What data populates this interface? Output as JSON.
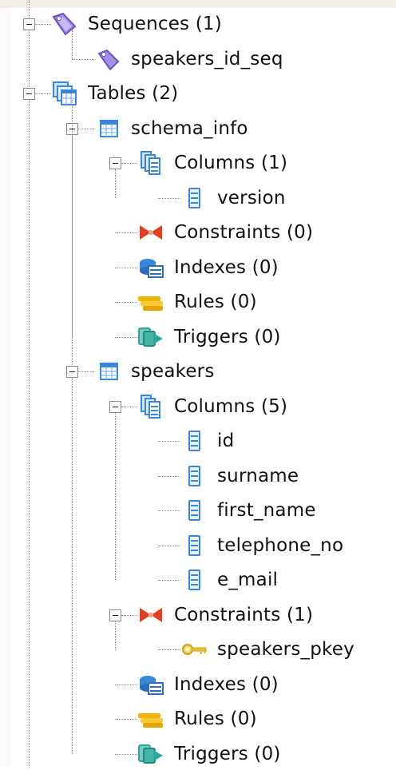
{
  "tree": {
    "sequences": {
      "label": "Sequences (1)",
      "icon": "sequences-icon",
      "items": [
        {
          "label": "speakers_id_seq",
          "icon": "sequence-icon"
        }
      ]
    },
    "tables": {
      "label": "Tables (2)",
      "icon": "tables-icon",
      "items": [
        {
          "label": "schema_info",
          "icon": "table-icon",
          "columns": {
            "label": "Columns (1)",
            "icon": "columns-icon",
            "items": [
              "version"
            ]
          },
          "constraints": {
            "label": "Constraints (0)",
            "icon": "constraints-icon",
            "items": []
          },
          "indexes": {
            "label": "Indexes (0)",
            "icon": "indexes-icon"
          },
          "rules": {
            "label": "Rules (0)",
            "icon": "rules-icon"
          },
          "triggers": {
            "label": "Triggers (0)",
            "icon": "triggers-icon"
          }
        },
        {
          "label": "speakers",
          "icon": "table-icon",
          "columns": {
            "label": "Columns (5)",
            "icon": "columns-icon",
            "items": [
              "id",
              "surname",
              "first_name",
              "telephone_no",
              "e_mail"
            ]
          },
          "constraints": {
            "label": "Constraints (1)",
            "icon": "constraints-icon",
            "items": [
              "speakers_pkey"
            ]
          },
          "indexes": {
            "label": "Indexes (0)",
            "icon": "indexes-icon"
          },
          "rules": {
            "label": "Rules (0)",
            "icon": "rules-icon"
          },
          "triggers": {
            "label": "Triggers (0)",
            "icon": "triggers-icon"
          }
        }
      ]
    }
  },
  "colors": {
    "sequence": "#8a6fd8",
    "table_blue": "#3a86d9",
    "constraint_red": "#e04020",
    "rule_yellow": "#f2b400",
    "trigger_teal": "#2aa89c",
    "key_yellow": "#e8c33a"
  }
}
